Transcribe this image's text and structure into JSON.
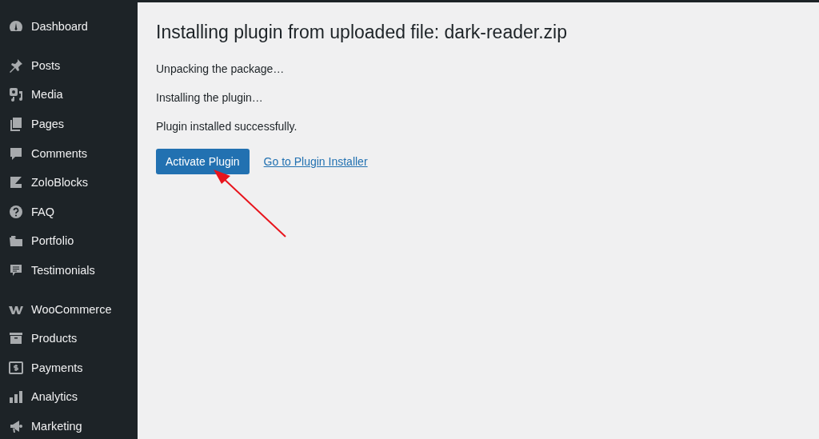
{
  "sidebar": {
    "groups": [
      {
        "items": [
          {
            "label": "Dashboard"
          }
        ]
      },
      {
        "items": [
          {
            "label": "Posts"
          },
          {
            "label": "Media"
          },
          {
            "label": "Pages"
          },
          {
            "label": "Comments"
          },
          {
            "label": "ZoloBlocks"
          },
          {
            "label": "FAQ"
          },
          {
            "label": "Portfolio"
          },
          {
            "label": "Testimonials"
          }
        ]
      },
      {
        "items": [
          {
            "label": "WooCommerce"
          },
          {
            "label": "Products"
          },
          {
            "label": "Payments"
          },
          {
            "label": "Analytics"
          },
          {
            "label": "Marketing"
          }
        ]
      }
    ]
  },
  "main": {
    "title": "Installing plugin from uploaded file: dark-reader.zip",
    "messages": [
      "Unpacking the package…",
      "Installing the plugin…",
      "Plugin installed successfully."
    ],
    "primary_button": "Activate Plugin",
    "link": "Go to Plugin Installer"
  }
}
